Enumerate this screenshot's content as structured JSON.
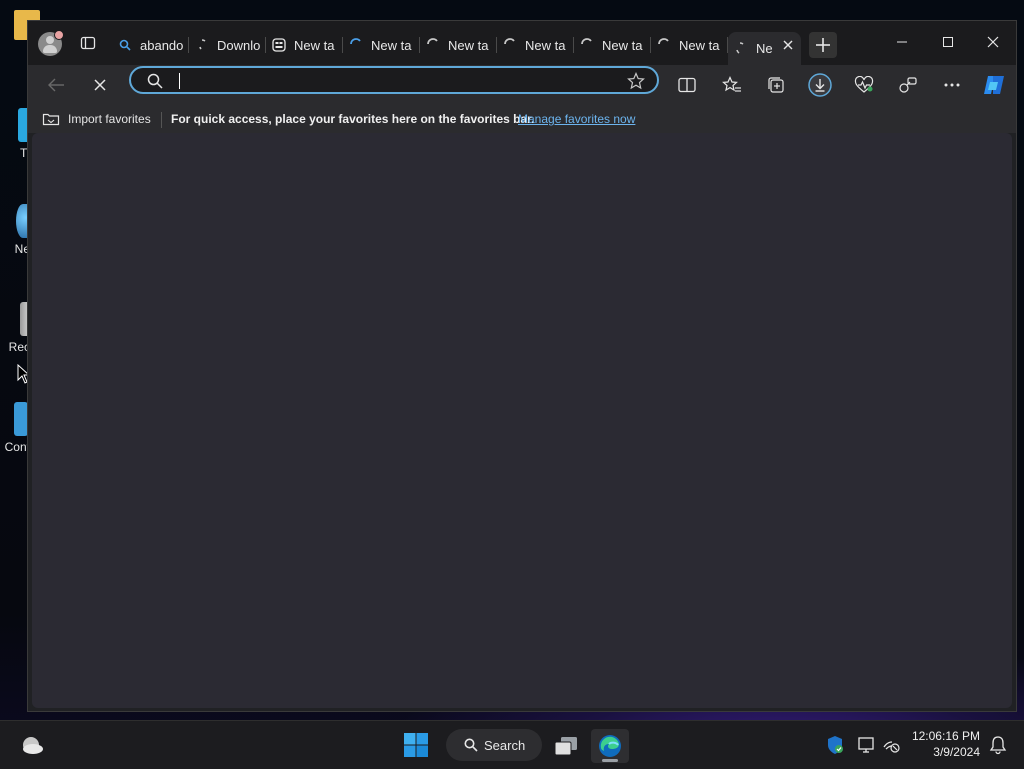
{
  "desktop": {
    "icons": [
      {
        "label": "Tl"
      },
      {
        "label": "Ne"
      },
      {
        "label": "Rec"
      },
      {
        "label": "Cont"
      }
    ]
  },
  "browser": {
    "tabs": [
      {
        "label": "abando",
        "icon": "search-icon"
      },
      {
        "label": "Downlo",
        "icon": "loading-icon"
      },
      {
        "label": "New ta",
        "icon": "newtab-page-icon"
      },
      {
        "label": "New ta",
        "icon": "loading-icon"
      },
      {
        "label": "New ta",
        "icon": "loading-icon"
      },
      {
        "label": "New ta",
        "icon": "loading-icon"
      },
      {
        "label": "New ta",
        "icon": "loading-icon"
      },
      {
        "label": "New ta",
        "icon": "loading-icon"
      },
      {
        "label": "Ne",
        "icon": "loading-icon",
        "active": true
      }
    ],
    "address_value": "",
    "favorites_bar": {
      "import_label": "Import favorites",
      "message": "For quick access, place your favorites here on the favorites bar.",
      "manage_link": "Manage favorites now"
    },
    "colors": {
      "accent": "#5fa8d8",
      "link": "#6cb4ee",
      "content_bg": "#2b2a33"
    }
  },
  "taskbar": {
    "search_label": "Search",
    "time": "12:06:16 PM",
    "date": "3/9/2024"
  }
}
